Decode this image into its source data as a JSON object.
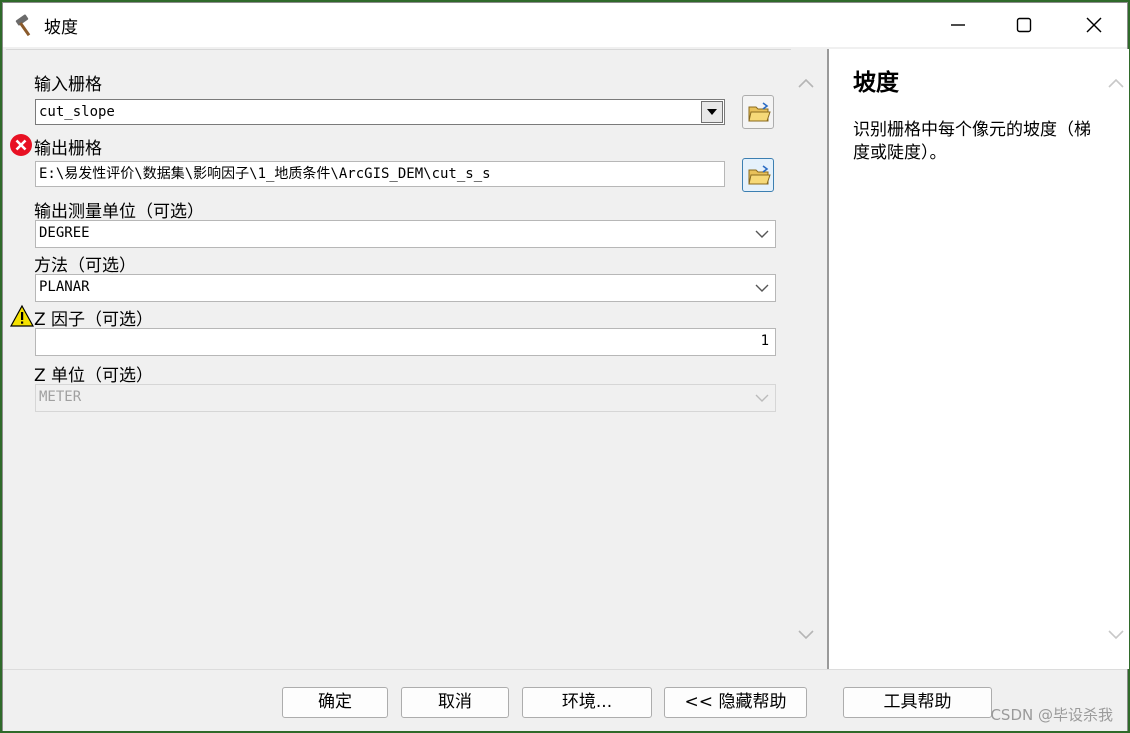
{
  "window": {
    "title": "坡度",
    "controls": {
      "minimize": "minimize-icon",
      "maximize": "maximize-icon",
      "close": "close-icon"
    }
  },
  "form": {
    "input_raster": {
      "label": "输入栅格",
      "value": "cut_slope"
    },
    "output_raster": {
      "label": "输出栅格",
      "value": "E:\\易发性评价\\数据集\\影响因子\\1_地质条件\\ArcGIS_DEM\\cut_s_s",
      "status": "error"
    },
    "measurement": {
      "label": "输出测量单位（可选）",
      "value": "DEGREE"
    },
    "method": {
      "label": "方法（可选）",
      "value": "PLANAR"
    },
    "z_factor": {
      "label": "Z 因子（可选）",
      "value": "1",
      "status": "warning"
    },
    "z_unit": {
      "label": "Z 单位（可选）",
      "value": "METER",
      "disabled": true
    }
  },
  "help": {
    "title": "坡度",
    "body": "识别栅格中每个像元的坡度（梯度或陡度）。"
  },
  "buttons": {
    "ok": "确定",
    "cancel": "取消",
    "environments": "环境...",
    "hide_help": "<< 隐藏帮助",
    "tool_help": "工具帮助"
  },
  "watermark": "CSDN @毕设杀我",
  "colors": {
    "error": "#e81123",
    "warning": "#f5e200",
    "folder": "#e8c15a"
  }
}
